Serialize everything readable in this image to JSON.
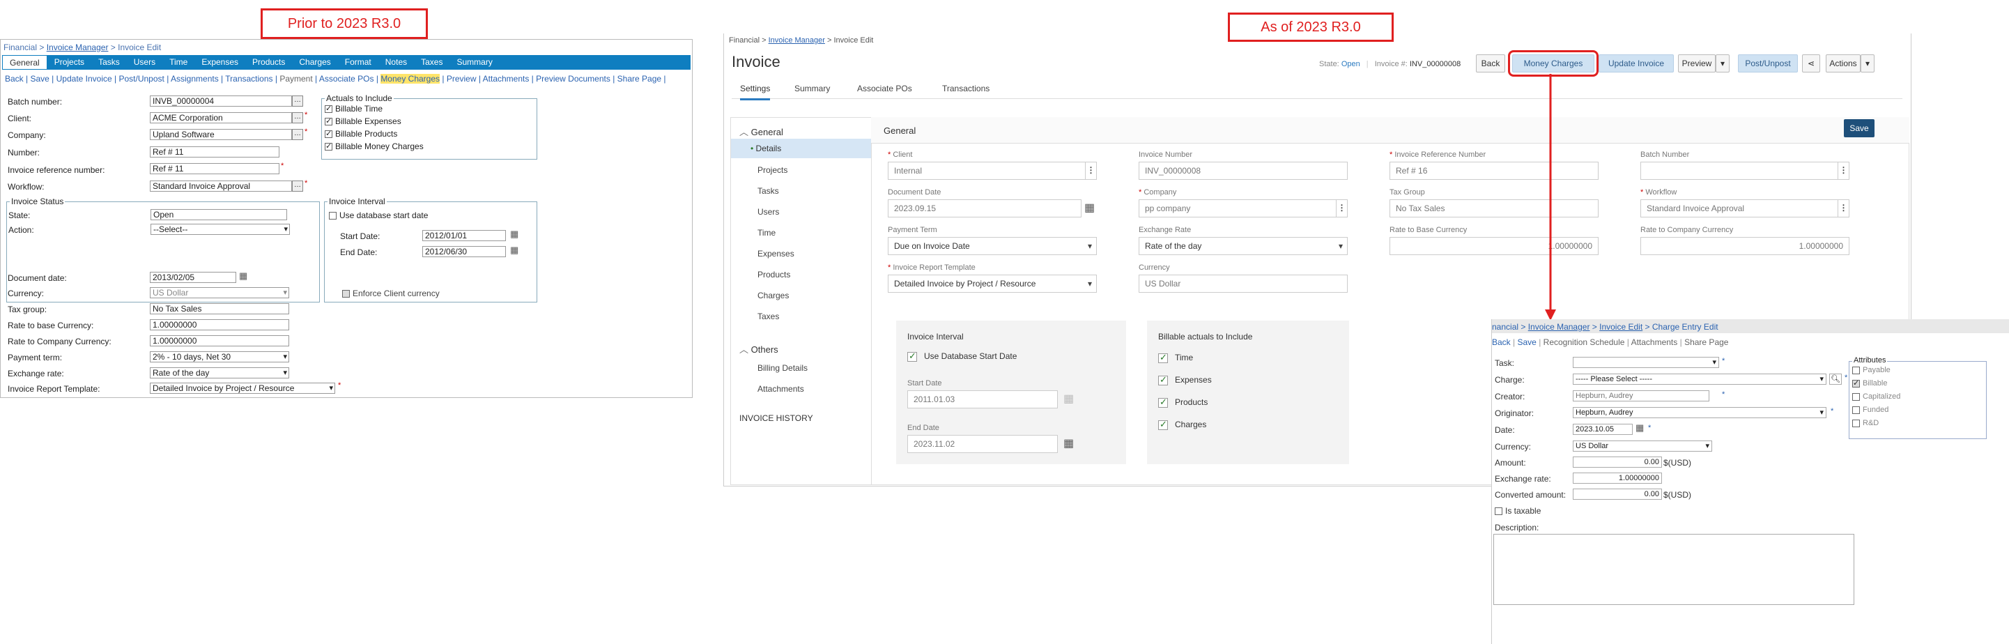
{
  "labels": {
    "prior": "Prior to 2023 R3.0",
    "asof": "As of 2023 R3.0"
  },
  "old": {
    "crumb": {
      "a": "Financial",
      "b": "Invoice Manager",
      "c": "Invoice Edit"
    },
    "tabs": [
      "General",
      "Projects",
      "Tasks",
      "Users",
      "Time",
      "Expenses",
      "Products",
      "Charges",
      "Format",
      "Notes",
      "Taxes",
      "Summary"
    ],
    "links": [
      "Back",
      "Save",
      "Update Invoice",
      "Post/Unpost",
      "Assignments",
      "Transactions",
      "Payment",
      "Associate POs",
      "Money Charges",
      "Preview",
      "Attachments",
      "Preview Documents",
      "Share Page"
    ],
    "fields": {
      "batch_label": "Batch number:",
      "batch": "INVB_00000004",
      "client_label": "Client:",
      "client": "ACME Corporation",
      "company_label": "Company:",
      "company": "Upland Software",
      "number_label": "Number:",
      "number": "Ref # 11",
      "ref_label": "Invoice reference number:",
      "ref": "Ref # 11",
      "workflow_label": "Workflow:",
      "workflow": "Standard Invoice Approval"
    },
    "actuals": {
      "title": "Actuals to Include",
      "items": [
        "Billable Time",
        "Billable Expenses",
        "Billable Products",
        "Billable Money Charges"
      ]
    },
    "status": {
      "title": "Invoice Status",
      "state_label": "State:",
      "state": "Open",
      "action_label": "Action:",
      "action": "--Select--"
    },
    "interval": {
      "title": "Invoice Interval",
      "use_db": "Use database start date",
      "start_label": "Start Date:",
      "start": "2012/01/01",
      "end_label": "End Date:",
      "end": "2012/06/30"
    },
    "lower": {
      "docdate_label": "Document date:",
      "docdate": "2013/02/05",
      "currency_label": "Currency:",
      "currency": "US Dollar",
      "enforce": "Enforce Client currency",
      "taxgroup_label": "Tax group:",
      "taxgroup": "No Tax Sales",
      "rbase_label": "Rate to base Currency:",
      "rbase": "1.00000000",
      "rcomp_label": "Rate to Company Currency:",
      "rcomp": "1.00000000",
      "term_label": "Payment term:",
      "term": "2% - 10 days, Net 30",
      "exch_label": "Exchange rate:",
      "exch": "Rate of the day",
      "tmpl_label": "Invoice Report Template:",
      "tmpl": "Detailed Invoice by Project / Resource"
    }
  },
  "new": {
    "crumb": {
      "a": "Financial",
      "b": "Invoice Manager",
      "c": "Invoice Edit"
    },
    "title": "Invoice",
    "state_label": "State:",
    "state": "Open",
    "invno_label": "Invoice #:",
    "invno": "INV_00000008",
    "buttons": {
      "back": "Back",
      "money": "Money Charges",
      "update": "Update Invoice",
      "preview": "Preview",
      "post": "Post/Unpost",
      "actions": "Actions"
    },
    "tabs": [
      "Settings",
      "Summary",
      "Associate POs",
      "Transactions"
    ],
    "nav": {
      "general": "General",
      "items": [
        "Details",
        "Projects",
        "Tasks",
        "Users",
        "Time",
        "Expenses",
        "Products",
        "Charges",
        "Taxes"
      ],
      "others": "Others",
      "others_items": [
        "Billing Details",
        "Attachments"
      ],
      "history": "INVOICE HISTORY"
    },
    "section": "General",
    "save": "Save",
    "form": {
      "client_l": "Client",
      "client": "Internal",
      "invnum_l": "Invoice Number",
      "invnum": "INV_00000008",
      "invref_l": "Invoice Reference Number",
      "invref": "Ref # 16",
      "batch_l": "Batch Number",
      "batch": "",
      "docdate_l": "Document Date",
      "docdate": "2023.09.15",
      "company_l": "Company",
      "company": "pp company",
      "taxgroup_l": "Tax Group",
      "taxgroup": "No Tax Sales",
      "workflow_l": "Workflow",
      "workflow": "Standard Invoice Approval",
      "term_l": "Payment Term",
      "term": "Due on Invoice Date",
      "exch_l": "Exchange Rate",
      "exch": "Rate of the day",
      "rbase_l": "Rate to Base Currency",
      "rbase": "1.00000000",
      "rcomp_l": "Rate to Company Currency",
      "rcomp": "1.00000000",
      "tmpl_l": "Invoice Report Template",
      "tmpl": "Detailed Invoice by Project / Resource",
      "curr_l": "Currency",
      "curr": "US Dollar"
    },
    "interval": {
      "title": "Invoice Interval",
      "use_db": "Use Database Start Date",
      "start_l": "Start Date",
      "start": "2011.01.03",
      "end_l": "End Date",
      "end": "2023.11.02"
    },
    "billable": {
      "title": "Billable actuals to Include",
      "items": [
        "Time",
        "Expenses",
        "Products",
        "Charges"
      ]
    }
  },
  "charge": {
    "crumb": {
      "a": "nancial",
      "b": "Invoice Manager",
      "c": "Invoice Edit",
      "d": "Charge Entry Edit"
    },
    "links": [
      "Back",
      "Save",
      "Recognition Schedule",
      "Attachments",
      "Share Page"
    ],
    "task_l": "Task:",
    "charge_l": "Charge:",
    "charge": "----- Please Select -----",
    "creator_l": "Creator:",
    "creator": "Hepburn, Audrey",
    "orig_l": "Originator:",
    "orig": "Hepburn, Audrey",
    "date_l": "Date:",
    "date": "2023.10.05",
    "curr_l": "Currency:",
    "curr": "US Dollar",
    "amount_l": "Amount:",
    "amount": "0.00",
    "unit": "$(USD)",
    "exrate_l": "Exchange rate:",
    "exrate": "1.00000000",
    "conv_l": "Converted amount:",
    "conv": "0.00",
    "taxable": "Is taxable",
    "desc_l": "Description:",
    "attr": {
      "title": "Attributes",
      "items": [
        "Payable",
        "Billable",
        "Capitalized",
        "Funded",
        "R&D"
      ]
    }
  }
}
